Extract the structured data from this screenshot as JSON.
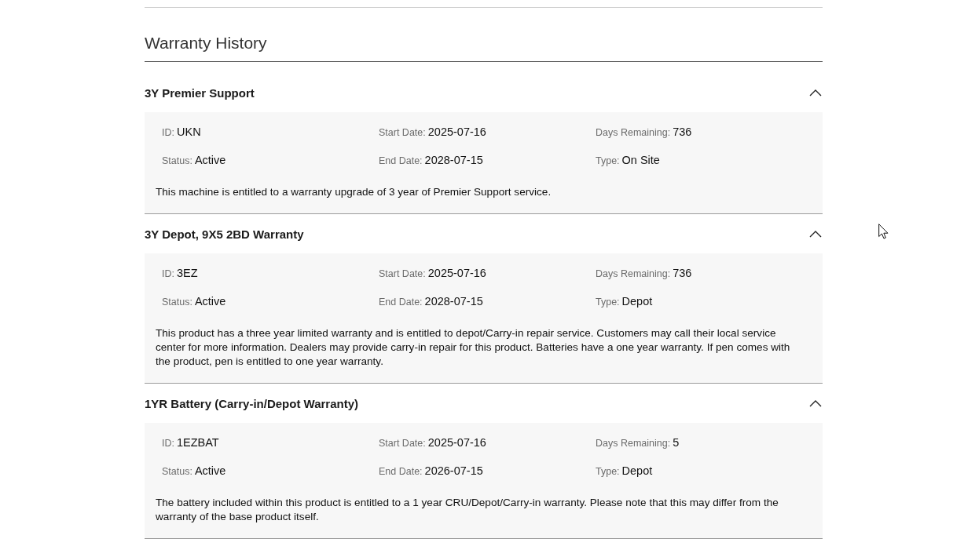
{
  "title": "Warranty History",
  "warranties": [
    {
      "name": "3Y Premier Support",
      "expanded": true,
      "fields": [
        {
          "label": "ID:",
          "value": "UKN"
        },
        {
          "label": "Start Date:",
          "value": "2025-07-16"
        },
        {
          "label": "Days Remaining:",
          "value": "736"
        },
        {
          "label": "Status:",
          "value": "Active"
        },
        {
          "label": "End Date:",
          "value": "2028-07-15"
        },
        {
          "label": "Type:",
          "value": "On Site"
        }
      ],
      "description": "This machine is entitled to a warranty upgrade of 3 year of Premier Support service."
    },
    {
      "name": "3Y Depot, 9X5 2BD Warranty",
      "expanded": true,
      "fields": [
        {
          "label": "ID:",
          "value": "3EZ"
        },
        {
          "label": "Start Date:",
          "value": "2025-07-16"
        },
        {
          "label": "Days Remaining:",
          "value": "736"
        },
        {
          "label": "Status:",
          "value": "Active"
        },
        {
          "label": "End Date:",
          "value": "2028-07-15"
        },
        {
          "label": "Type:",
          "value": "Depot"
        }
      ],
      "description": "This product has a three year limited warranty and is entitled to depot/Carry-in repair service. Customers may call their local service center for more information. Dealers may provide carry-in repair for this product. Batteries have a one year warranty. If pen comes with the product, pen is entitled to one year warranty."
    },
    {
      "name": "1YR Battery (Carry-in/Depot Warranty)",
      "expanded": true,
      "fields": [
        {
          "label": "ID:",
          "value": "1EZBAT"
        },
        {
          "label": "Start Date:",
          "value": "2025-07-16"
        },
        {
          "label": "Days Remaining:",
          "value": "5"
        },
        {
          "label": "Status:",
          "value": "Active"
        },
        {
          "label": "End Date:",
          "value": "2026-07-15"
        },
        {
          "label": "Type:",
          "value": "Depot"
        }
      ],
      "description": "The battery included within this product is entitled to a 1 year CRU/Depot/Carry-in warranty. Please note that this may differ from the warranty of the base product itself."
    }
  ]
}
